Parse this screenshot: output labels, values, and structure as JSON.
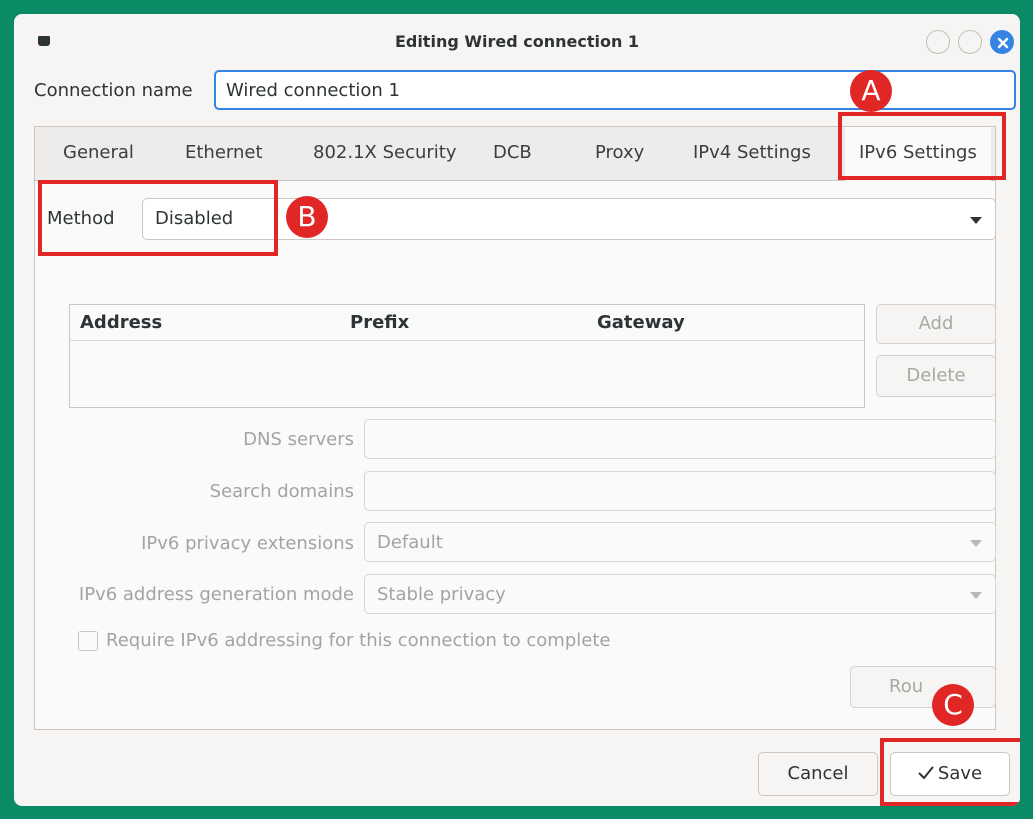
{
  "window": {
    "title": "Editing Wired connection 1"
  },
  "connection": {
    "label": "Connection name",
    "value": "Wired connection 1"
  },
  "tabs": [
    {
      "label": "General"
    },
    {
      "label": "Ethernet"
    },
    {
      "label": "802.1X Security"
    },
    {
      "label": "DCB"
    },
    {
      "label": "Proxy"
    },
    {
      "label": "IPv4 Settings"
    },
    {
      "label": "IPv6 Settings",
      "active": true
    }
  ],
  "method": {
    "label": "Method",
    "value": "Disabled"
  },
  "addresses": {
    "columns": [
      "Address",
      "Prefix",
      "Gateway"
    ],
    "rows": []
  },
  "buttons": {
    "add": "Add",
    "delete": "Delete",
    "routes": "Rou",
    "cancel": "Cancel",
    "save": "Save",
    "save_icon": "checkmark-icon"
  },
  "fields": {
    "dns_label": "DNS servers",
    "dns_value": "",
    "search_label": "Search domains",
    "search_value": "",
    "privacy_label": "IPv6 privacy extensions",
    "privacy_value": "Default",
    "genmode_label": "IPv6 address generation mode",
    "genmode_value": "Stable privacy"
  },
  "require_ipv6": {
    "label": "Require IPv6 addressing for this connection to complete",
    "checked": false
  },
  "annotations": {
    "a": "A",
    "b": "B",
    "c": "C",
    "color": "#e12626"
  },
  "colors": {
    "accent": "#3584e4",
    "background": "#0b8a66"
  }
}
